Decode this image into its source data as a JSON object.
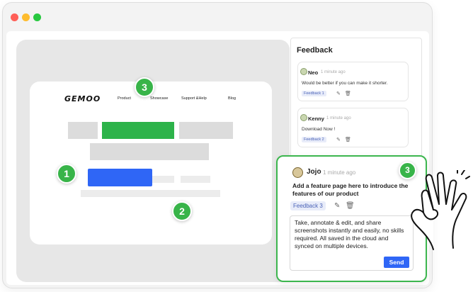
{
  "window": {
    "controls": [
      "close",
      "minimize",
      "maximize"
    ]
  },
  "webpage": {
    "logo": "GEMOO",
    "nav": [
      "Product",
      "Showcase",
      "Support &Help",
      "Blog"
    ]
  },
  "badges": {
    "one": "1",
    "two": "2",
    "three": "3"
  },
  "feedback_panel": {
    "title": "Feedback",
    "items": [
      {
        "user": "Neo",
        "time": "1 minute ago",
        "message": "Would be better if you can make it shorter.",
        "tag": "Feedback 1"
      },
      {
        "user": "Kenny",
        "time": "1 minute ago",
        "message": "Download Now !",
        "tag": "Feedback 2"
      }
    ]
  },
  "active_feedback": {
    "user": "Jojo",
    "time": "1 minute ago",
    "message": "Add a feature page here to introduce the features of our product",
    "tag": "Feedback 3",
    "reply_text": "Take, annotate & edit, and share screenshots instantly and easily, no skills required. All saved in the cloud and synced on multiple devices.",
    "send_label": "Send",
    "badge": "3"
  },
  "colors": {
    "accent_green": "#38b449",
    "accent_blue": "#2f66f6",
    "tag_bg": "#e8ecf9"
  },
  "icons": [
    "edit-icon",
    "trash-icon",
    "ok-hand-icon"
  ]
}
